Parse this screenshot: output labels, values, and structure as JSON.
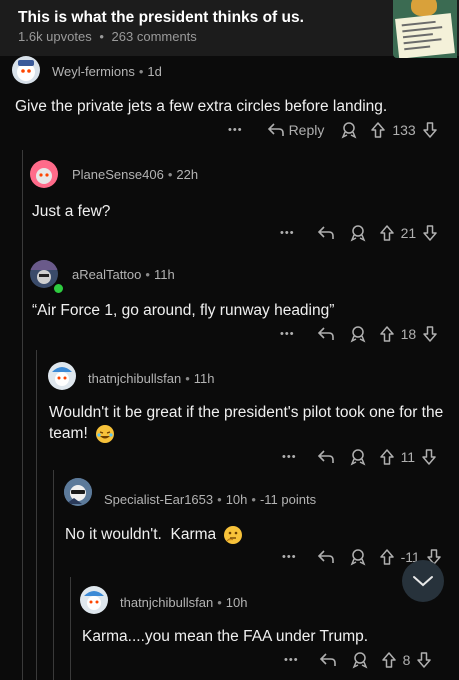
{
  "post": {
    "title": "This is what the president thinks of us.",
    "upvotes": "1.6k upvotes",
    "comments": "263 comments",
    "separator": "•"
  },
  "actions": {
    "more": "•••",
    "reply": "Reply"
  },
  "comments": [
    {
      "username": "Weyl-fermions",
      "time": "1d",
      "text": "Give the private jets a few extra circles before landing.",
      "votes": "133"
    },
    {
      "username": "PlaneSense406",
      "time": "22h",
      "text": "Just a few?",
      "votes": "21"
    },
    {
      "username": "aRealTattoo",
      "time": "11h",
      "text": "“Air Force 1, go around, fly runway heading”",
      "votes": "18"
    },
    {
      "username": "thatnjchibullsfan",
      "time": "11h",
      "text": "Wouldn't it be great if the president's pilot took one for the team!",
      "votes": "11"
    },
    {
      "username": "Specialist-Ear1653",
      "time": "10h",
      "points": "-11 points",
      "text": "No it wouldn't.  Karma",
      "votes": "-11"
    },
    {
      "username": "thatnjchibullsfan",
      "time": "10h",
      "text": "Karma....you mean the FAA under Trump.",
      "votes": "8"
    }
  ],
  "colors": {
    "background": "#0b0b0b",
    "header": "#1c1c1c",
    "online": "#2ecc40"
  }
}
